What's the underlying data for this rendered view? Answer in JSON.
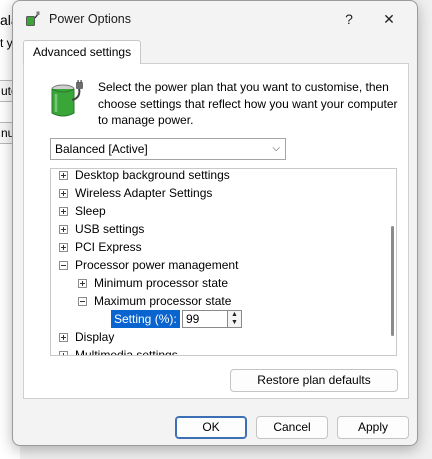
{
  "background_window": {
    "fragments": [
      "ala",
      "t y",
      "ute",
      "nut"
    ]
  },
  "dialog": {
    "title": "Power Options",
    "help_glyph": "?",
    "close_glyph": "✕",
    "tab_label": "Advanced settings",
    "description": "Select the power plan that you want to customise, then choose settings that reflect how you want your computer to manage power.",
    "plan_select": {
      "value": "Balanced [Active]",
      "chevron": "⌵"
    },
    "tree": {
      "items": [
        {
          "label": "Desktop background settings",
          "state": "collapsed"
        },
        {
          "label": "Wireless Adapter Settings",
          "state": "collapsed"
        },
        {
          "label": "Sleep",
          "state": "collapsed"
        },
        {
          "label": "USB settings",
          "state": "collapsed"
        },
        {
          "label": "PCI Express",
          "state": "collapsed"
        },
        {
          "label": "Processor power management",
          "state": "expanded"
        },
        {
          "label": "Minimum processor state",
          "state": "collapsed"
        },
        {
          "label": "Maximum processor state",
          "state": "expanded"
        },
        {
          "label": "Display",
          "state": "collapsed"
        },
        {
          "label": "Multimedia settings",
          "state": "collapsed"
        }
      ],
      "setting_label": "Setting (%):",
      "setting_value": "99"
    },
    "restore_label": "Restore plan defaults",
    "ok_label": "OK",
    "cancel_label": "Cancel",
    "apply_label": "Apply"
  },
  "colors": {
    "selection": "#0a64cf",
    "dialog_bg": "#f3f3f3",
    "panel_bg": "#ffffff",
    "icon_green": "#3aa63a"
  },
  "icons": {
    "app": "power-options-icon",
    "plan": "battery-plug-icon"
  }
}
